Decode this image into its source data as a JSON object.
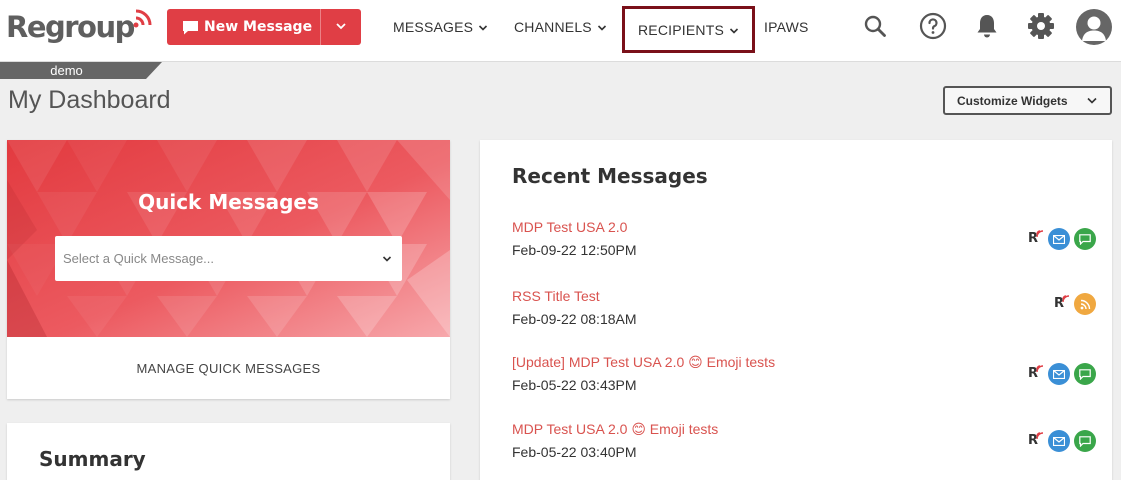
{
  "brand": {
    "logo_text": "Regroup"
  },
  "toolbar": {
    "new_message_label": "New Message"
  },
  "nav": {
    "messages": "MESSAGES",
    "channels": "CHANNELS",
    "recipients": "RECIPIENTS",
    "ipaws": "IPAWS"
  },
  "environment_tab": "demo",
  "page": {
    "title": "My Dashboard",
    "customize_label": "Customize Widgets"
  },
  "quick_messages": {
    "title": "Quick Messages",
    "select_placeholder": "Select a Quick Message...",
    "manage_label": "MANAGE QUICK MESSAGES"
  },
  "summary": {
    "title": "Summary"
  },
  "recent_messages": {
    "title": "Recent Messages",
    "items": [
      {
        "title": "MDP Test USA 2.0",
        "date": "Feb-09-22 12:50PM",
        "channels": [
          "regroup",
          "email",
          "sms"
        ]
      },
      {
        "title": "RSS Title Test",
        "date": "Feb-09-22 08:18AM",
        "channels": [
          "regroup",
          "rss"
        ]
      },
      {
        "title": "[Update] MDP Test USA 2.0 😊 Emoji tests",
        "date": "Feb-05-22 03:43PM",
        "channels": [
          "regroup",
          "email",
          "sms"
        ]
      },
      {
        "title": "MDP Test USA 2.0 😊 Emoji tests",
        "date": "Feb-05-22 03:40PM",
        "channels": [
          "regroup",
          "email",
          "sms"
        ]
      }
    ]
  },
  "colors": {
    "brand_red": "#e03e45",
    "link_red": "#d9534f",
    "email_blue": "#3a8fd6",
    "sms_green": "#3aa64a",
    "rss_orange": "#f0a840",
    "highlight_border": "#7a1019"
  }
}
